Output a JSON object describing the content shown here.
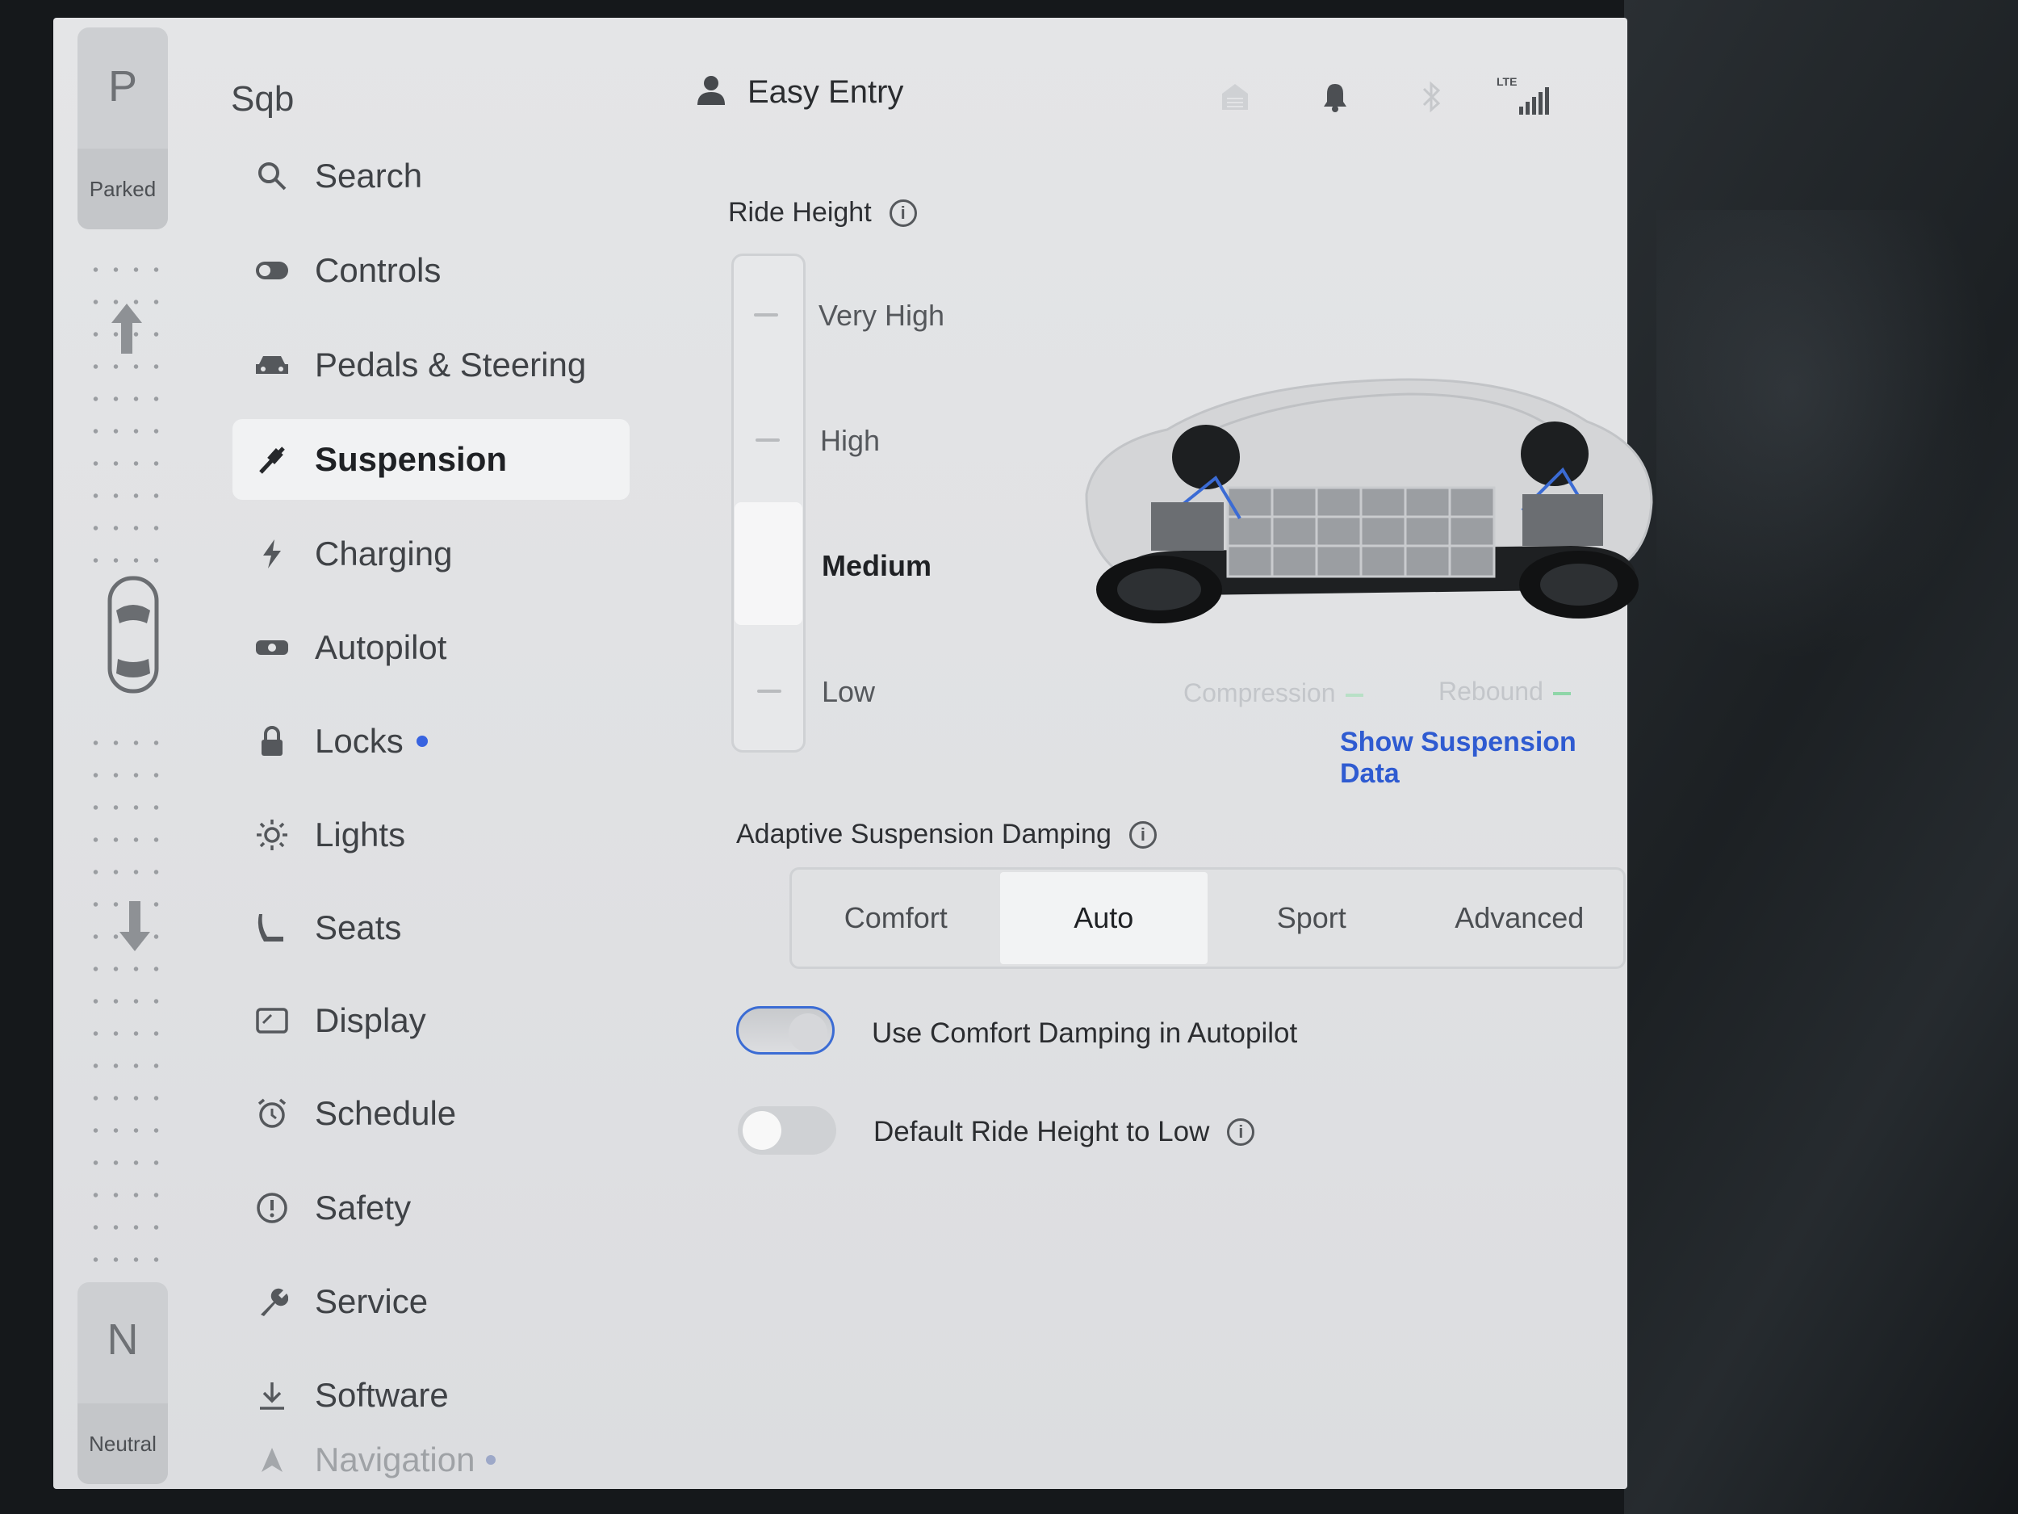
{
  "gear": {
    "top_letter": "P",
    "top_label": "Parked",
    "bottom_letter": "N",
    "bottom_label": "Neutral"
  },
  "sidebar": {
    "brand": "Sqb",
    "items": [
      {
        "label": "Search",
        "icon": "search-icon"
      },
      {
        "label": "Controls",
        "icon": "toggle-icon"
      },
      {
        "label": "Pedals & Steering",
        "icon": "car-icon"
      },
      {
        "label": "Suspension",
        "icon": "shock-absorber-icon",
        "active": true
      },
      {
        "label": "Charging",
        "icon": "lightning-icon"
      },
      {
        "label": "Autopilot",
        "icon": "steering-wheel-icon"
      },
      {
        "label": "Locks",
        "icon": "lock-icon",
        "badge": true
      },
      {
        "label": "Lights",
        "icon": "sun-icon"
      },
      {
        "label": "Seats",
        "icon": "seat-icon"
      },
      {
        "label": "Display",
        "icon": "display-icon"
      },
      {
        "label": "Schedule",
        "icon": "alarm-clock-icon"
      },
      {
        "label": "Safety",
        "icon": "alert-circle-icon"
      },
      {
        "label": "Service",
        "icon": "wrench-icon"
      },
      {
        "label": "Software",
        "icon": "download-icon"
      },
      {
        "label": "Navigation",
        "icon": "navigation-arrow-icon",
        "badge": true
      }
    ]
  },
  "header": {
    "profile_name": "Easy Entry",
    "status_icons": [
      "garage-icon",
      "bell-icon",
      "bluetooth-icon",
      "lte-signal-icon"
    ],
    "lte_text": "LTE"
  },
  "ride_height": {
    "title": "Ride Height",
    "levels": [
      "Very High",
      "High",
      "Medium",
      "Low"
    ],
    "selected": "Medium",
    "legend": {
      "compression": "Compression",
      "rebound": "Rebound"
    },
    "link": "Show Suspension Data"
  },
  "damping": {
    "title": "Adaptive Suspension Damping",
    "options": [
      "Comfort",
      "Auto",
      "Sport",
      "Advanced"
    ],
    "selected": "Auto"
  },
  "toggles": [
    {
      "label": "Use Comfort Damping in Autopilot",
      "on": true
    },
    {
      "label": "Default Ride Height to Low",
      "on": false,
      "info": true
    }
  ],
  "colors": {
    "accent": "#3863e0",
    "link": "#2f5bd1",
    "active_row": "#f1f2f3"
  }
}
